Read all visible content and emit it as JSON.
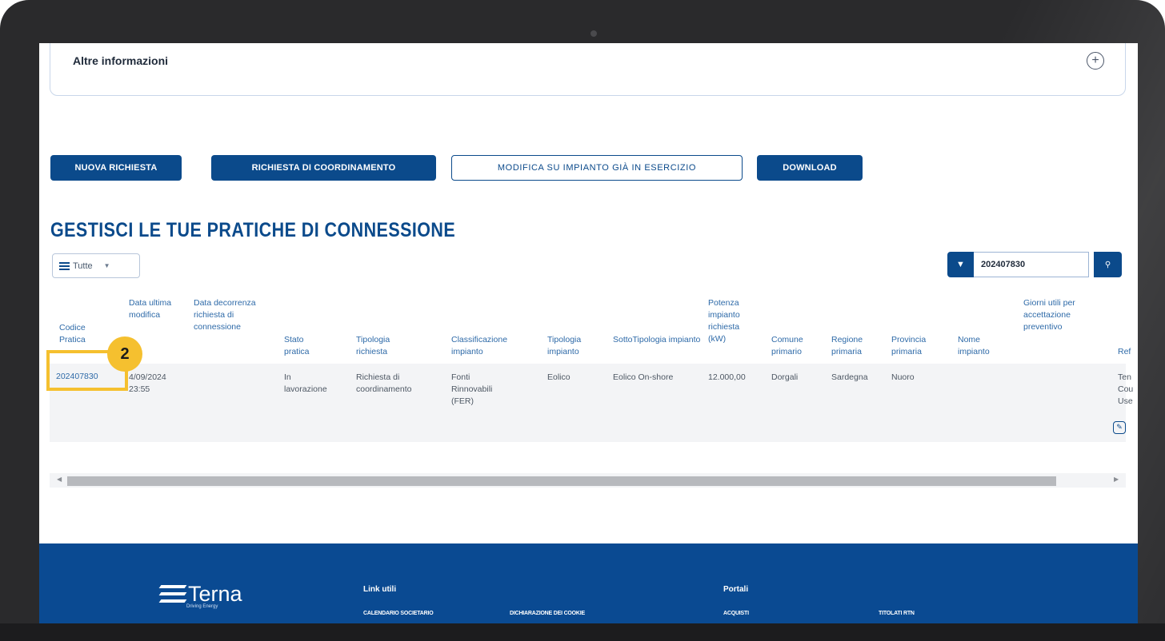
{
  "info_panel": {
    "title": "Altre informazioni",
    "expand_icon": "+"
  },
  "buttons": {
    "new_request": "NUOVA RICHIESTA",
    "coordination": "RICHIESTA DI COORDINAMENTO",
    "modify": "MODIFICA SU IMPIANTO GIÀ IN ESERCIZIO",
    "download": "DOWNLOAD"
  },
  "section_title": "GESTISCI LE TUE PRATICHE DI CONNESSIONE",
  "filter": {
    "selected": "Tutte",
    "icon": "list-icon"
  },
  "search": {
    "value": "202407830",
    "filter_icon": "filter-icon",
    "search_icon": "search-icon"
  },
  "table": {
    "headers": {
      "codice": "Codice Pratica",
      "data_ultima": "Data ultima modifica",
      "data_decorrenza": "Data decorrenza richiesta di connessione",
      "stato": "Stato pratica",
      "tipologia_richiesta": "Tipologia richiesta",
      "classificazione": "Classificazione impianto",
      "tipologia_impianto": "Tipologia impianto",
      "sottotipologia": "SottoTipologia impianto",
      "potenza": "Potenza impianto richiesta (kW)",
      "comune": "Comune primario",
      "regione": "Regione primaria",
      "provincia": "Provincia primaria",
      "nome": "Nome impianto",
      "giorni": "Giorni utili per accettazione preventivo",
      "ref": "Ref"
    },
    "row": {
      "codice": "202407830",
      "data_ultima": "4/09/2024 23:55",
      "data_decorrenza": "",
      "stato": "In lavorazione",
      "tipologia_richiesta": "Richiesta di coordinamento",
      "classificazione": "Fonti Rinnovabili (FER)",
      "tipologia_impianto": "Eolico",
      "sottotipologia": "Eolico On-shore",
      "potenza": "12.000,00",
      "comune": "Dorgali",
      "regione": "Sardegna",
      "provincia": "Nuoro",
      "nome": "",
      "giorni": "",
      "ref": "Ten Cou Use"
    }
  },
  "annotation": {
    "step": "2",
    "highlight_color": "#f5c02f"
  },
  "footer": {
    "logo": "Terna",
    "logo_tagline": "Driving Energy",
    "col1_title": "Link utili",
    "col1_links": [
      "CALENDARIO SOCIETARIO",
      "DICHIARAZIONE DEI COOKIE"
    ],
    "col2_title": "Portali",
    "col2_links": [
      "ACQUISTI",
      "TITOLATI RTN"
    ]
  },
  "colors": {
    "brand_blue": "#0b4a8b",
    "footer_blue": "#0a4a92",
    "link_blue": "#2e6aa8"
  }
}
